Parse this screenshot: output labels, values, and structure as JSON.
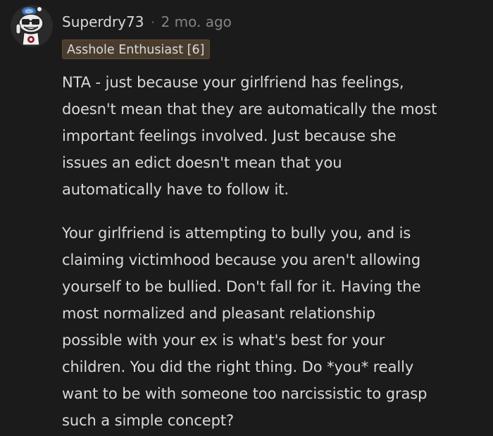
{
  "comment": {
    "username": "Superdry73",
    "separator": "·",
    "timestamp": "2 mo. ago",
    "flair": "Asshole Enthusiast [6]",
    "paragraphs": [
      {
        "lines": [
          "NTA - just because your girlfriend has feelings,",
          "doesn't mean that they are automatically the most",
          "important feelings involved. Just because she",
          "issues an edict doesn't mean that you",
          "automatically have to follow it."
        ]
      },
      {
        "lines": [
          "Your girlfriend is attempting to bully you, and is",
          "claiming victimhood because you aren't allowing",
          "yourself to be bullied. Don't fall for it. Having the",
          "most normalized and pleasant relationship",
          "possible with your ex is what's best for your",
          "children. You did the right thing. Do *you* really",
          "want to be with someone too narcissistic to grasp",
          "such a simple concept?"
        ]
      }
    ]
  },
  "colors": {
    "background": "#1b1b1b",
    "text": "#d7dadc",
    "muted": "#818384",
    "flair_bg": "#4a3c2c"
  },
  "icons": {
    "avatar": "snoo-avatar-icon"
  }
}
